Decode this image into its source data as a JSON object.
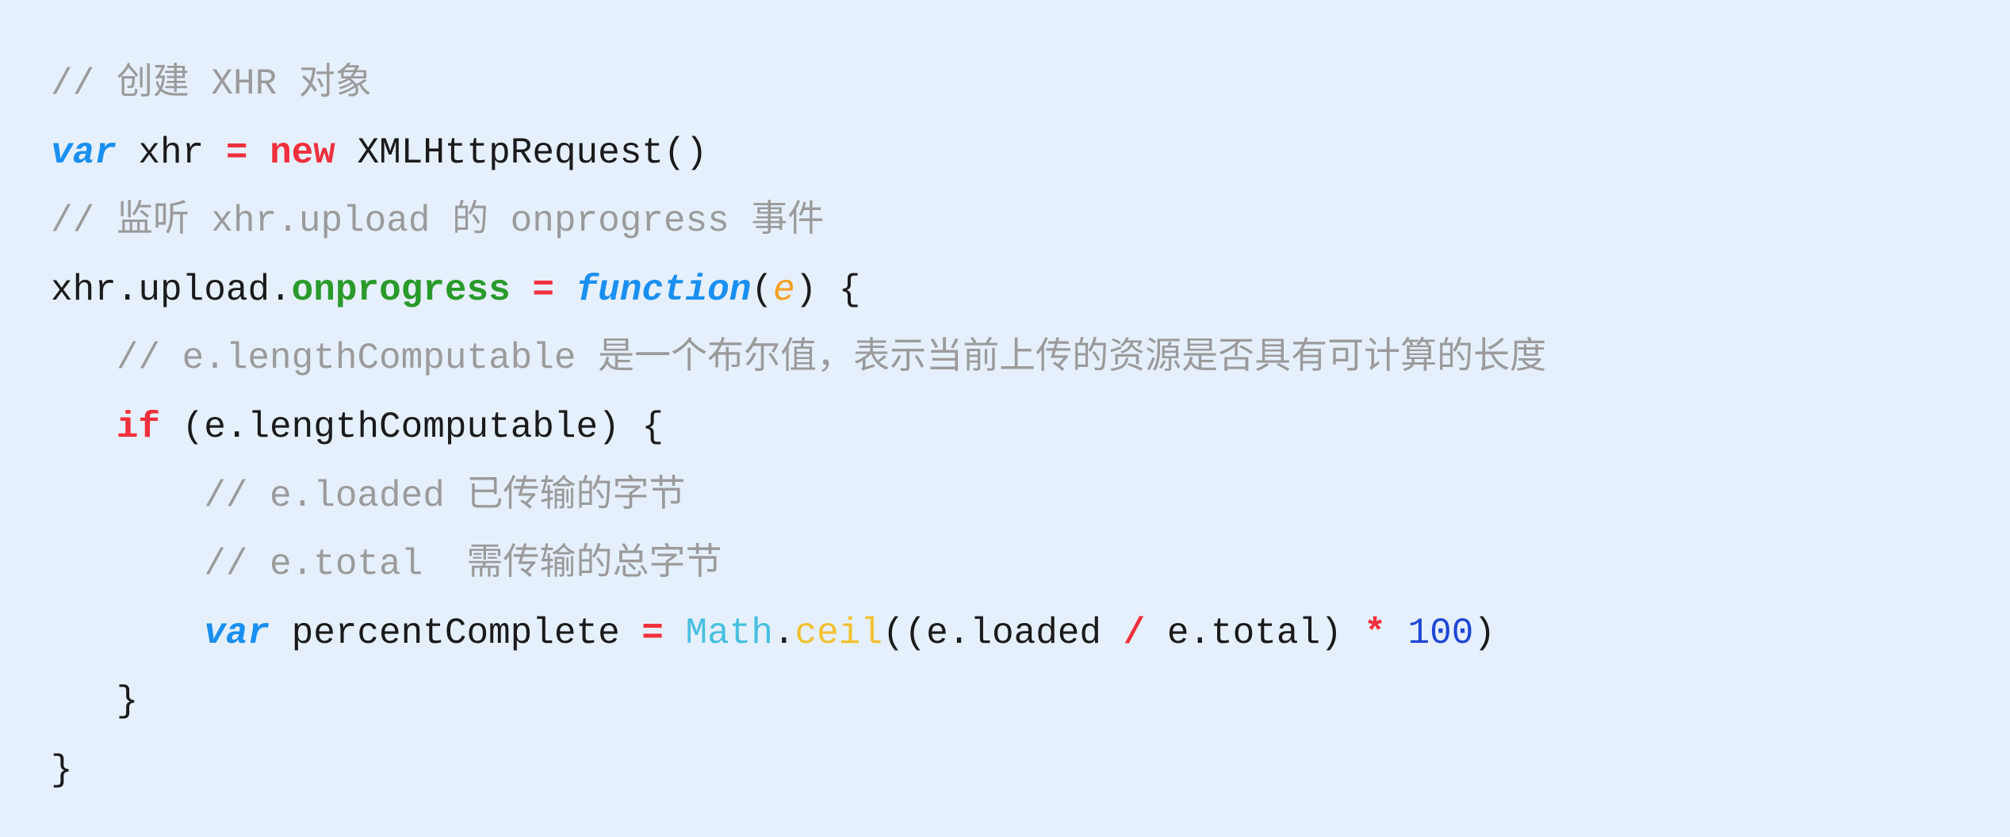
{
  "theme": {
    "background": "#e6f0fd",
    "comment": "#9b9b9b",
    "keyword": "#1a8ff2",
    "operator": "#f0303c",
    "property": "#2a9a2a",
    "parameter": "#f5a020",
    "builtin": "#47c0e0",
    "method": "#f2c12e",
    "number": "#1f47d6",
    "text": "#1a1a1a"
  },
  "code": {
    "lines": [
      {
        "indent": 0,
        "tokens": [
          {
            "type": "comment",
            "text": "// 创建 XHR 对象"
          }
        ]
      },
      {
        "indent": 0,
        "tokens": [
          {
            "type": "keyword",
            "text": "var"
          },
          {
            "type": "plain",
            "text": " xhr "
          },
          {
            "type": "op",
            "text": "="
          },
          {
            "type": "plain",
            "text": " "
          },
          {
            "type": "new",
            "text": "new"
          },
          {
            "type": "plain",
            "text": " XMLHttpRequest()"
          }
        ]
      },
      {
        "indent": 0,
        "tokens": [
          {
            "type": "comment",
            "text": "// 监听 xhr.upload 的 onprogress 事件"
          }
        ]
      },
      {
        "indent": 0,
        "tokens": [
          {
            "type": "plain",
            "text": "xhr.upload."
          },
          {
            "type": "prop",
            "text": "onprogress"
          },
          {
            "type": "plain",
            "text": " "
          },
          {
            "type": "op",
            "text": "="
          },
          {
            "type": "plain",
            "text": " "
          },
          {
            "type": "keyword",
            "text": "function"
          },
          {
            "type": "plain",
            "text": "("
          },
          {
            "type": "param",
            "text": "e"
          },
          {
            "type": "plain",
            "text": ") {"
          }
        ]
      },
      {
        "indent": 3,
        "tokens": [
          {
            "type": "comment",
            "text": "// e.lengthComputable 是一个布尔值，表示当前上传的资源是否具有可计算的长度"
          }
        ]
      },
      {
        "indent": 3,
        "tokens": [
          {
            "type": "new",
            "text": "if"
          },
          {
            "type": "plain",
            "text": " (e.lengthComputable) {"
          }
        ]
      },
      {
        "indent": 7,
        "tokens": [
          {
            "type": "comment",
            "text": "// e.loaded 已传输的字节"
          }
        ]
      },
      {
        "indent": 7,
        "tokens": [
          {
            "type": "comment",
            "text": "// e.total  需传输的总字节"
          }
        ]
      },
      {
        "indent": 7,
        "tokens": [
          {
            "type": "keyword",
            "text": "var"
          },
          {
            "type": "plain",
            "text": " percentComplete "
          },
          {
            "type": "op",
            "text": "="
          },
          {
            "type": "plain",
            "text": " "
          },
          {
            "type": "builtin",
            "text": "Math"
          },
          {
            "type": "plain",
            "text": "."
          },
          {
            "type": "method",
            "text": "ceil"
          },
          {
            "type": "plain",
            "text": "((e.loaded "
          },
          {
            "type": "op",
            "text": "/"
          },
          {
            "type": "plain",
            "text": " e.total) "
          },
          {
            "type": "op",
            "text": "*"
          },
          {
            "type": "plain",
            "text": " "
          },
          {
            "type": "number",
            "text": "100"
          },
          {
            "type": "plain",
            "text": ")"
          }
        ]
      },
      {
        "indent": 3,
        "tokens": [
          {
            "type": "plain",
            "text": "}"
          }
        ]
      },
      {
        "indent": 0,
        "tokens": [
          {
            "type": "plain",
            "text": "}"
          }
        ]
      }
    ]
  }
}
